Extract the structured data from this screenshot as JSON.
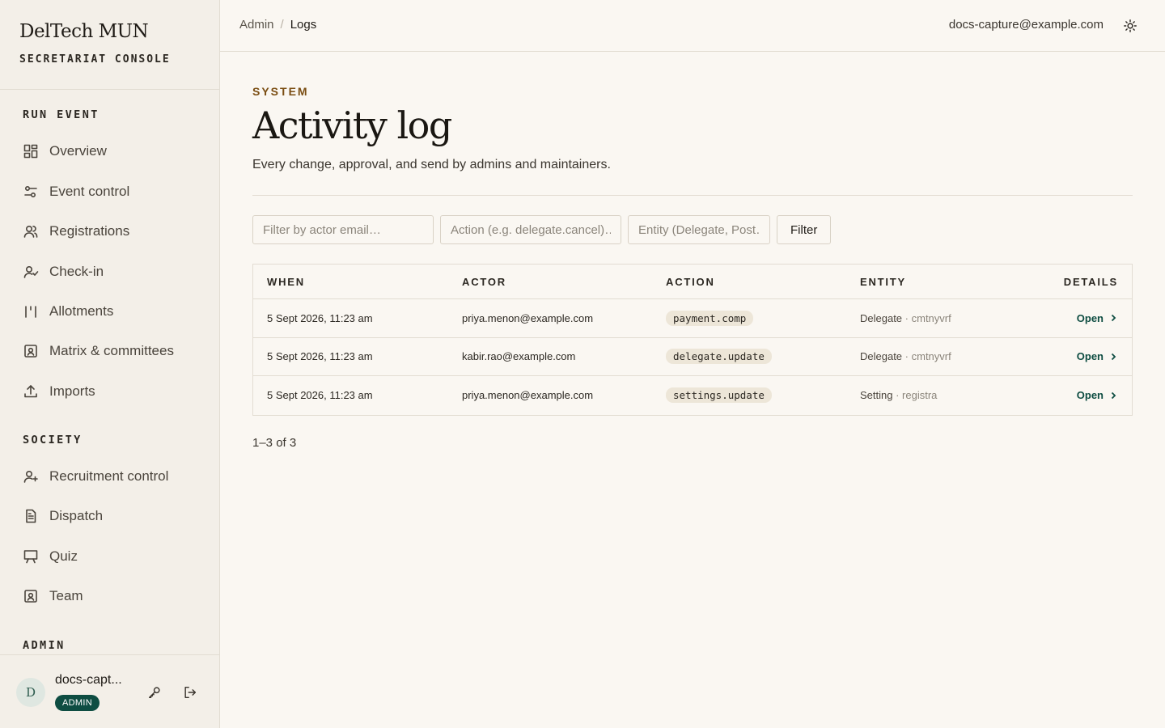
{
  "brand": {
    "name": "DelTech MUN",
    "subtitle": "SECRETARIAT CONSOLE"
  },
  "sidebar": {
    "sections": [
      {
        "title": "RUN EVENT",
        "items": [
          {
            "label": "Overview",
            "icon": "grid-icon"
          },
          {
            "label": "Event control",
            "icon": "sliders-icon"
          },
          {
            "label": "Registrations",
            "icon": "users-icon"
          },
          {
            "label": "Check-in",
            "icon": "user-check-icon"
          },
          {
            "label": "Allotments",
            "icon": "columns-icon"
          },
          {
            "label": "Matrix & committees",
            "icon": "id-badge-icon"
          },
          {
            "label": "Imports",
            "icon": "upload-icon"
          }
        ]
      },
      {
        "title": "SOCIETY",
        "items": [
          {
            "label": "Recruitment control",
            "icon": "user-plus-icon"
          },
          {
            "label": "Dispatch",
            "icon": "document-icon"
          },
          {
            "label": "Quiz",
            "icon": "presentation-icon"
          },
          {
            "label": "Team",
            "icon": "id-badge-icon"
          }
        ]
      },
      {
        "title": "ADMIN",
        "items": []
      }
    ],
    "footer": {
      "avatar_initial": "D",
      "user_name": "docs-capt...",
      "role": "ADMIN"
    }
  },
  "topbar": {
    "breadcrumb": [
      "Admin",
      "Logs"
    ],
    "user_email": "docs-capture@example.com"
  },
  "page": {
    "eyebrow": "SYSTEM",
    "title": "Activity log",
    "description": "Every change, approval, and send by admins and maintainers."
  },
  "filters": {
    "actor_placeholder": "Filter by actor email…",
    "action_placeholder": "Action (e.g. delegate.cancel)…",
    "entity_placeholder": "Entity (Delegate, Post…",
    "button_label": "Filter"
  },
  "table": {
    "columns": [
      "WHEN",
      "ACTOR",
      "ACTION",
      "ENTITY",
      "DETAILS"
    ],
    "rows": [
      {
        "when": "5 Sept 2026, 11:23 am",
        "actor": "priya.menon@example.com",
        "action": "payment.comp",
        "entity_type": "Delegate",
        "entity_id": "cmtnyvrf",
        "details": "Open"
      },
      {
        "when": "5 Sept 2026, 11:23 am",
        "actor": "kabir.rao@example.com",
        "action": "delegate.update",
        "entity_type": "Delegate",
        "entity_id": "cmtnyvrf",
        "details": "Open"
      },
      {
        "when": "5 Sept 2026, 11:23 am",
        "actor": "priya.menon@example.com",
        "action": "settings.update",
        "entity_type": "Setting",
        "entity_id": "registra",
        "details": "Open"
      }
    ]
  },
  "pagination": {
    "label": "1–3 of 3"
  },
  "colors": {
    "accent": "#0e4d42",
    "eyebrow": "#7a4d12",
    "background": "#faf7f2",
    "sidebar": "#f3efe8"
  }
}
